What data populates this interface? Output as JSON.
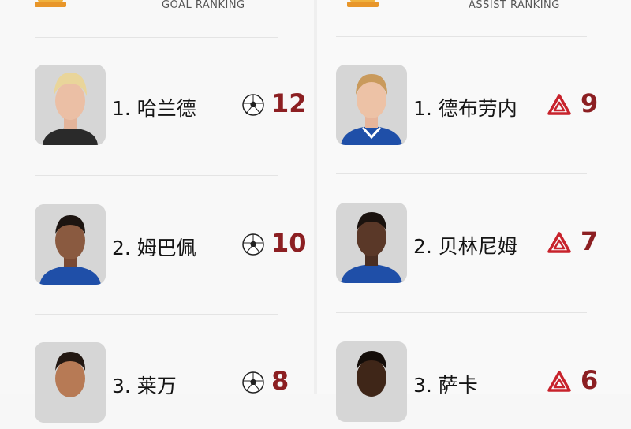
{
  "goals": {
    "title": "GOAL RANKING",
    "players": [
      {
        "rank_name": "1. 哈兰德",
        "value": "12"
      },
      {
        "rank_name": "2. 姆巴佩",
        "value": "10"
      },
      {
        "rank_name": "3. 莱万",
        "value": "8"
      }
    ]
  },
  "assists": {
    "title": "ASSIST RANKING",
    "players": [
      {
        "rank_name": "1. 德布劳内",
        "value": "9"
      },
      {
        "rank_name": "2. 贝林尼姆",
        "value": "7"
      },
      {
        "rank_name": "3. 萨卡",
        "value": "6"
      }
    ]
  },
  "colors": {
    "accent": "#8c1f22",
    "assist_icon": "#c8232c",
    "trophy": "#e8a030"
  },
  "icons": {
    "goal": "soccer-ball-icon",
    "assist": "assist-triangle-icon",
    "header": "trophy-icon"
  }
}
